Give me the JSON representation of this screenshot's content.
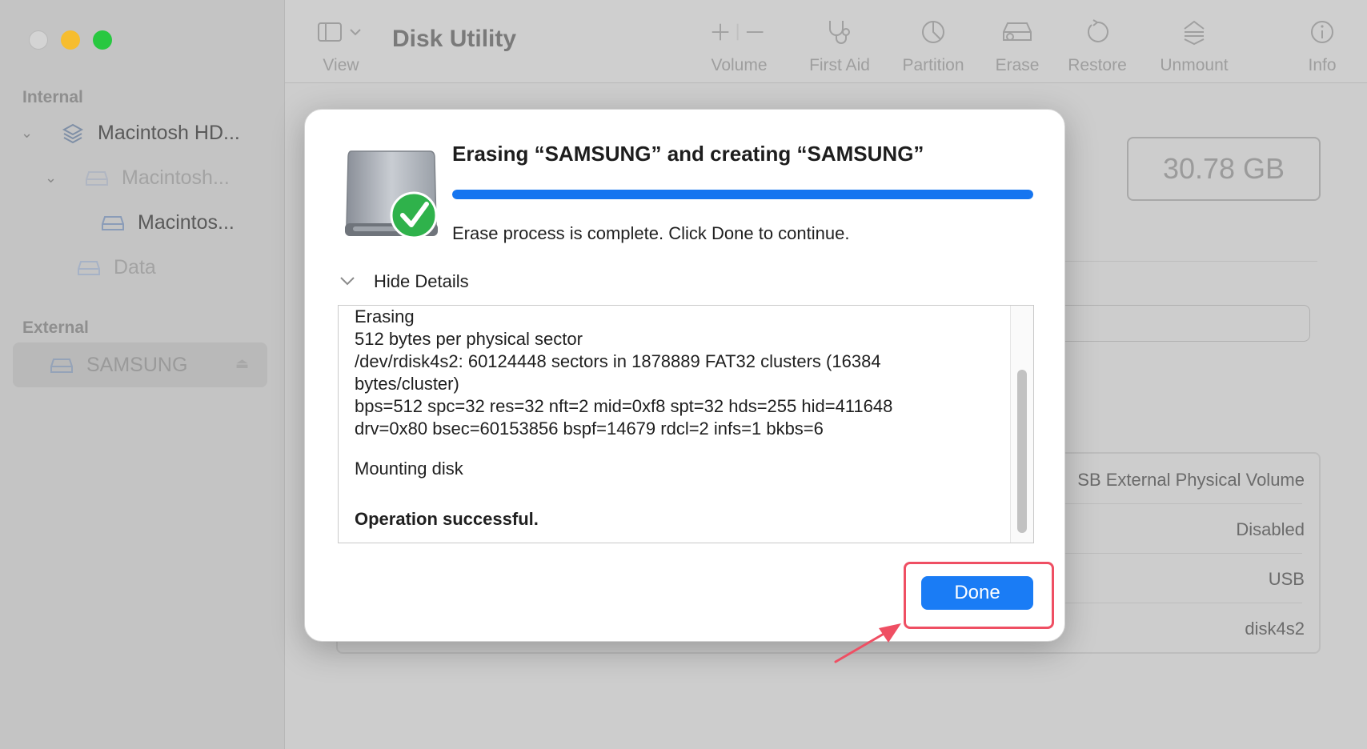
{
  "window": {
    "title": "Disk Utility"
  },
  "sidebar": {
    "sections": [
      {
        "label": "Internal"
      },
      {
        "label": "External"
      }
    ],
    "items": [
      {
        "label": "Macintosh HD..."
      },
      {
        "label": "Macintosh..."
      },
      {
        "label": "Macintos..."
      },
      {
        "label": "Data"
      },
      {
        "label": "SAMSUNG"
      }
    ]
  },
  "toolbar": {
    "view_label": "View",
    "buttons": [
      {
        "label": "Volume",
        "icon": "plus-minus-icon"
      },
      {
        "label": "First Aid",
        "icon": "stethoscope-icon"
      },
      {
        "label": "Partition",
        "icon": "pie-chart-icon"
      },
      {
        "label": "Erase",
        "icon": "eraser-drive-icon"
      },
      {
        "label": "Restore",
        "icon": "restore-icon"
      },
      {
        "label": "Unmount",
        "icon": "unmount-icon"
      },
      {
        "label": "Info",
        "icon": "info-icon"
      }
    ]
  },
  "content": {
    "capacity": "30.78 GB",
    "info_rows": [
      {
        "value": "SB External Physical Volume"
      },
      {
        "value": "Disabled"
      },
      {
        "value": "USB"
      },
      {
        "value": "disk4s2"
      }
    ]
  },
  "dialog": {
    "title": "Erasing “SAMSUNG” and creating “SAMSUNG”",
    "progress": 1.0,
    "status": "Erase process is complete. Click Done to continue.",
    "details_toggle": "Hide Details",
    "log": {
      "line1": "Erasing",
      "line2": "512 bytes per physical sector",
      "line3": "/dev/rdisk4s2: 60124448 sectors in 1878889 FAT32 clusters (16384",
      "line4": "bytes/cluster)",
      "line5": "bps=512 spc=32 res=32 nft=2 mid=0xf8 spt=32 hds=255 hid=411648",
      "line6": "drv=0x80 bsec=60153856 bspf=14679 rdcl=2 infs=1 bkbs=6",
      "line7": "Mounting disk",
      "line8": "Operation successful."
    },
    "done_label": "Done"
  },
  "colors": {
    "accent": "#1a7cf5",
    "highlight": "#ef4f63"
  }
}
